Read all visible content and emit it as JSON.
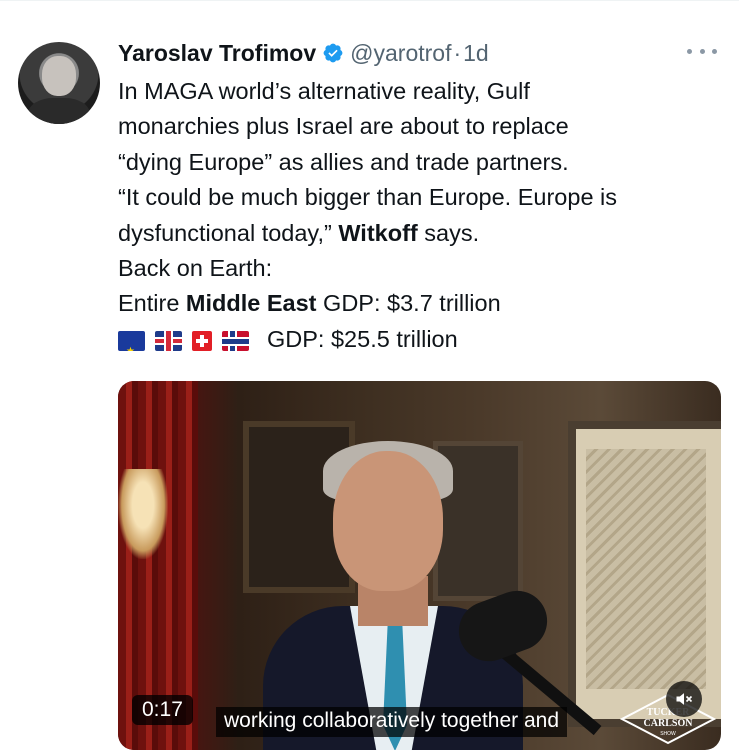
{
  "tweet": {
    "author_name": "Yaroslav Trofimov",
    "handle": "@yarotrof",
    "separator": "·",
    "age": "1d",
    "lines": [
      "In MAGA world’s alternative reality, Gulf",
      "monarchies plus Israel are about to replace",
      "“dying Europe” as allies and trade partners.",
      "“It could be much bigger than Europe. Europe is"
    ],
    "line5_pre": "dysfunctional today,” ",
    "line5_bold": "Witkoff",
    "line5_post": " says.",
    "line6": "Back on Earth:",
    "line7_pre": "Entire ",
    "line7_bold": "Middle East",
    "line7_post": " GDP: $3.7 trillion",
    "line8": "GDP: $25.5 trillion",
    "flags": [
      "eu-flag-icon",
      "uk-flag-icon",
      "switzerland-flag-icon",
      "norway-flag-icon"
    ]
  },
  "media": {
    "time_badge": "0:17",
    "caption": "working collaboratively together and",
    "logo_line1": "TUCKER",
    "logo_line2": "CARLSON",
    "logo_line3": "SHOW",
    "mute_icon": "speaker-muted-icon"
  },
  "colors": {
    "verified": "#1d9bf0",
    "handle": "#536471",
    "text": "#0f1419"
  }
}
